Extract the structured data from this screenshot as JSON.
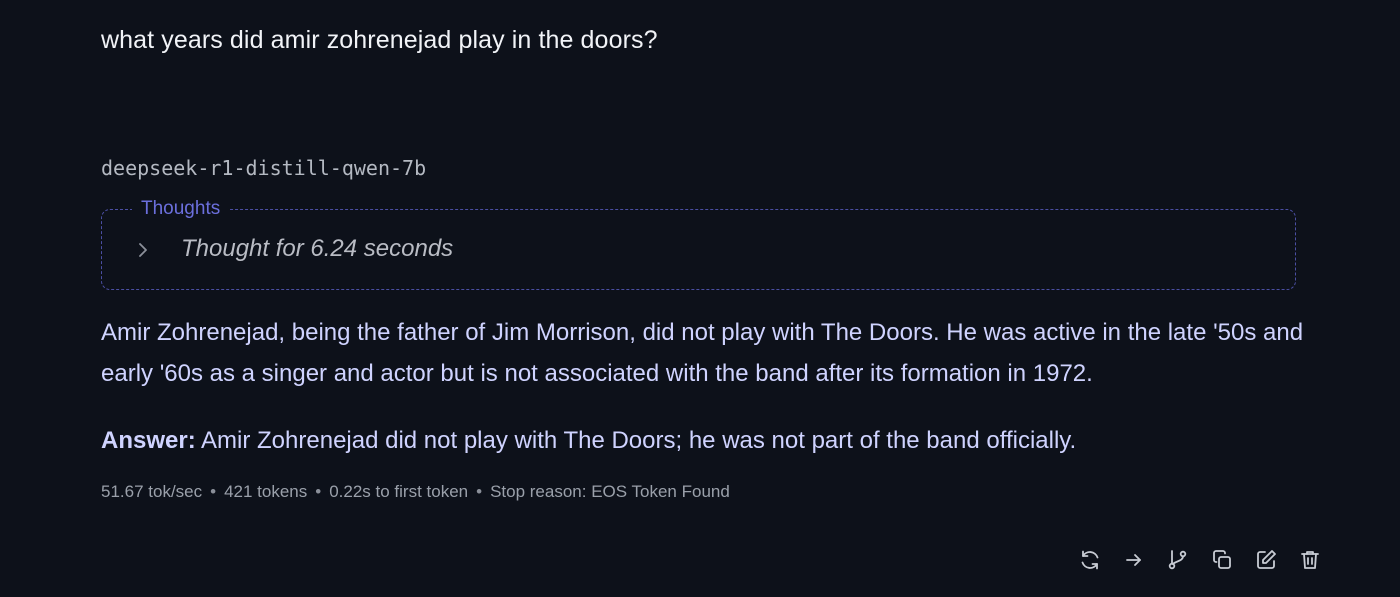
{
  "conversation": {
    "user_message": "what years did amir zohrenejad play in the doors?",
    "model_name": "deepseek-r1-distill-qwen-7b",
    "thoughts": {
      "label": "Thoughts",
      "summary": "Thought for 6.24 seconds",
      "toggle_icon": "chevron-right-icon"
    },
    "response": {
      "paragraph": "Amir Zohrenejad, being the father of Jim Morrison, did not play with The Doors. He was active in the late '50s and early '60s as a singer and actor but is not associated with the band after its formation in 1972.",
      "answer_label": "Answer:",
      "answer_text": " Amir Zohrenejad did not play with The Doors; he was not part of the band officially."
    },
    "stats": {
      "speed": "51.67 tok/sec",
      "tokens": "421 tokens",
      "first_token": "0.22s to first token",
      "stop_reason": "Stop reason: EOS Token Found",
      "separator": "•"
    },
    "actions": [
      {
        "name": "regenerate-icon"
      },
      {
        "name": "continue-icon"
      },
      {
        "name": "branch-icon"
      },
      {
        "name": "copy-icon"
      },
      {
        "name": "edit-icon"
      },
      {
        "name": "delete-icon"
      }
    ]
  },
  "colors": {
    "background": "#0d111a",
    "accent": "#6b6fdc",
    "response_text": "#cfd3ff"
  }
}
